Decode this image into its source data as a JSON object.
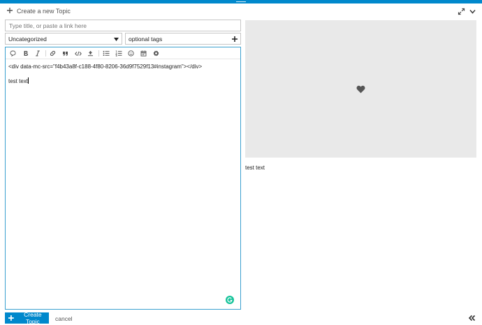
{
  "header": {
    "title": "Create a new Topic"
  },
  "title_field": {
    "placeholder": "Type title, or paste a link here",
    "value": ""
  },
  "category": {
    "selected": "Uncategorized"
  },
  "tags": {
    "placeholder": "optional tags"
  },
  "toolbar": {
    "buttons": [
      "quote-icon",
      "bold-icon",
      "italic-icon",
      "link-icon",
      "blockquote-icon",
      "code-icon",
      "upload-icon",
      "bullet-list-icon",
      "numbered-list-icon",
      "emoji-icon",
      "calendar-icon",
      "gear-icon"
    ]
  },
  "editor": {
    "line1": "<div data-mc-src=\"f4b43a8f-c188-4f80-8206-36d9f7529f13#instagram\"></div>",
    "line2": "test text"
  },
  "preview": {
    "text": "test text"
  },
  "footer": {
    "create_label": "Create Topic",
    "cancel_label": "cancel"
  },
  "colors": {
    "accent": "#0088cc",
    "editor_border": "#3aa0cf",
    "preview_bg": "#e9e9e9",
    "grammarly": "#15c39a"
  }
}
